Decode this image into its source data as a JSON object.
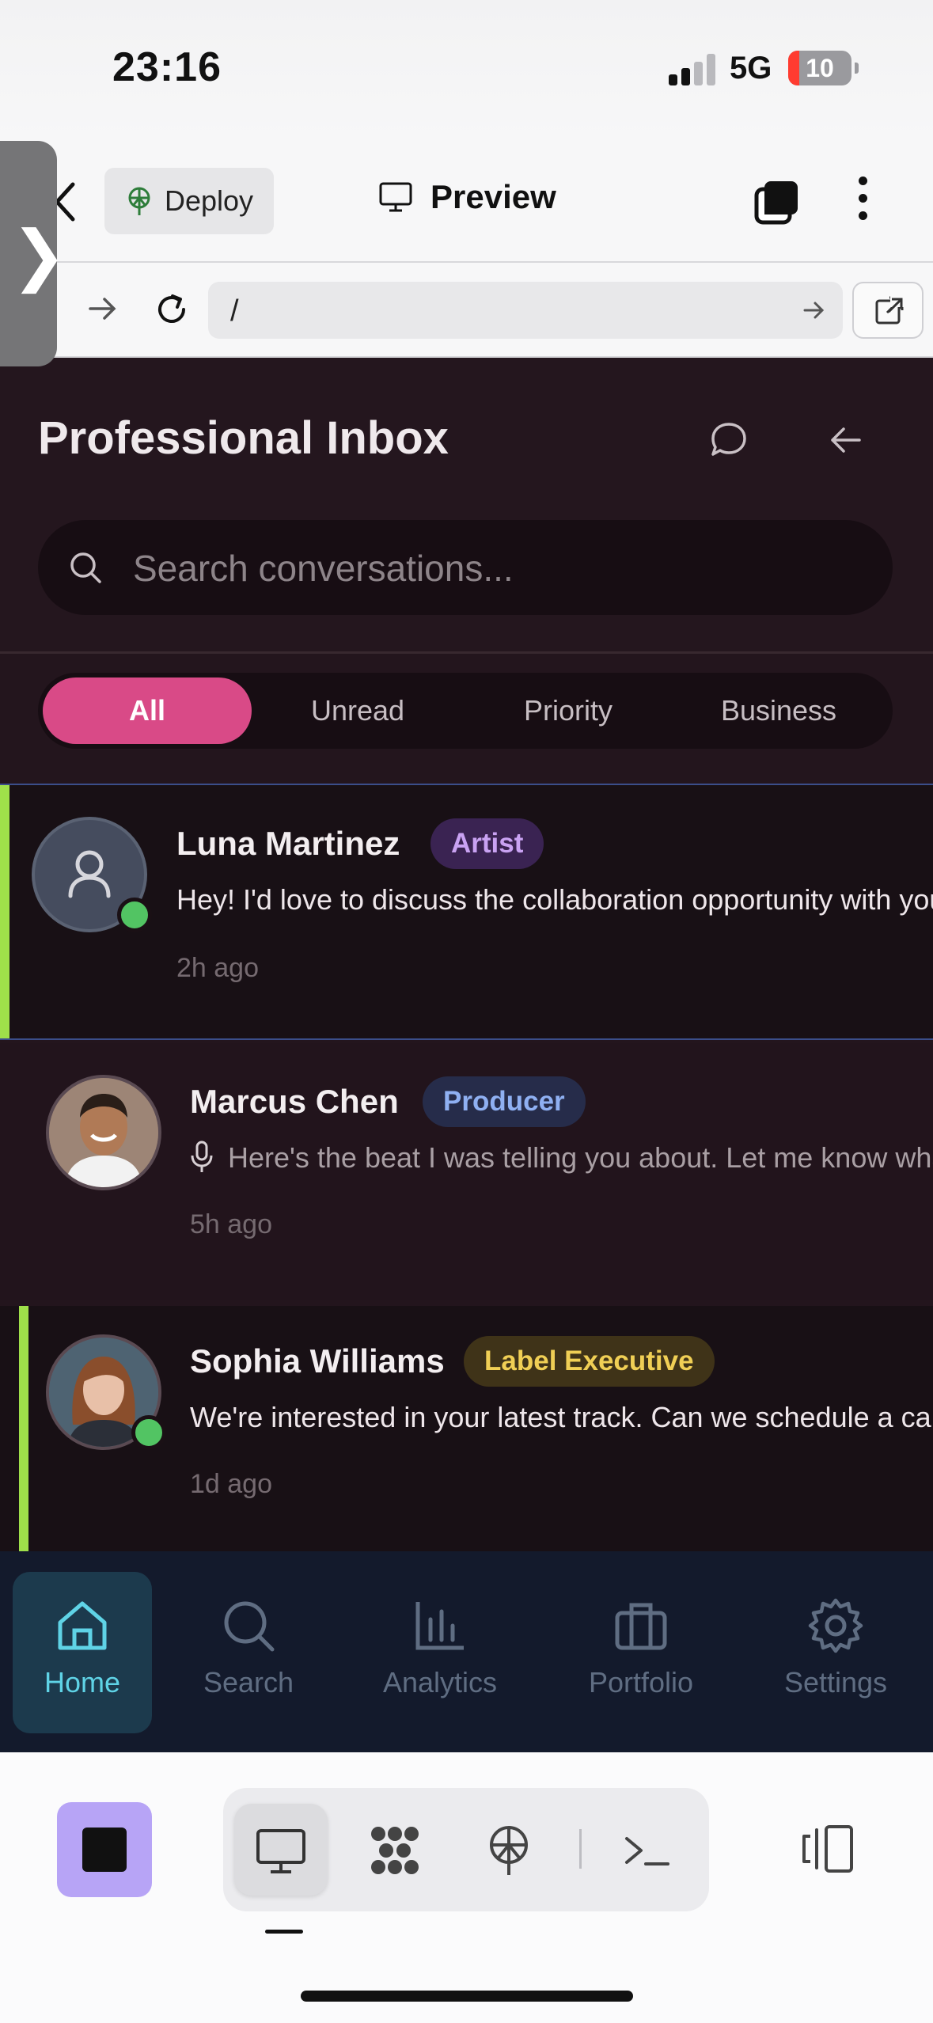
{
  "status_bar": {
    "time": "23:16",
    "network": "5G",
    "battery": "10"
  },
  "browser": {
    "deploy_label": "Deploy",
    "preview_label": "Preview",
    "url": "/"
  },
  "app": {
    "title": "Professional Inbox",
    "search_placeholder": "Search conversations...",
    "tabs": [
      {
        "label": "All",
        "active": true
      },
      {
        "label": "Unread",
        "active": false
      },
      {
        "label": "Priority",
        "active": false
      },
      {
        "label": "Business",
        "active": false
      }
    ],
    "conversations": [
      {
        "name": "Luna Martinez",
        "role": "Artist",
        "message": "Hey! I'd love to discuss the collaboration opportunity with you",
        "time": "2h ago",
        "online": true,
        "highlighted": true,
        "badge_color": "#3a2352",
        "badge_text_color": "#c9a2f2"
      },
      {
        "name": "Marcus Chen",
        "role": "Producer",
        "message": "Here's the beat I was telling you about. Let me know what you think",
        "time": "5h ago",
        "online": false,
        "voice": true,
        "badge_color": "#262c4a",
        "badge_text_color": "#8fb0f2"
      },
      {
        "name": "Sophia Williams",
        "role": "Label Executive",
        "message": "We're interested in your latest track. Can we schedule a call?",
        "time": "1d ago",
        "online": true,
        "badge_color": "#3f3318",
        "badge_text_color": "#f0cf55"
      }
    ],
    "nav": [
      {
        "label": "Home",
        "icon": "home-icon",
        "active": true
      },
      {
        "label": "Search",
        "icon": "search-icon",
        "active": false
      },
      {
        "label": "Analytics",
        "icon": "bar-chart-icon",
        "active": false
      },
      {
        "label": "Portfolio",
        "icon": "briefcase-icon",
        "active": false
      },
      {
        "label": "Settings",
        "icon": "gear-icon",
        "active": false
      }
    ]
  },
  "colors": {
    "accent": "#d94a87",
    "online": "#52c463",
    "priority_bar": "#9fe04a",
    "nav_active": "#5fd3e6"
  }
}
